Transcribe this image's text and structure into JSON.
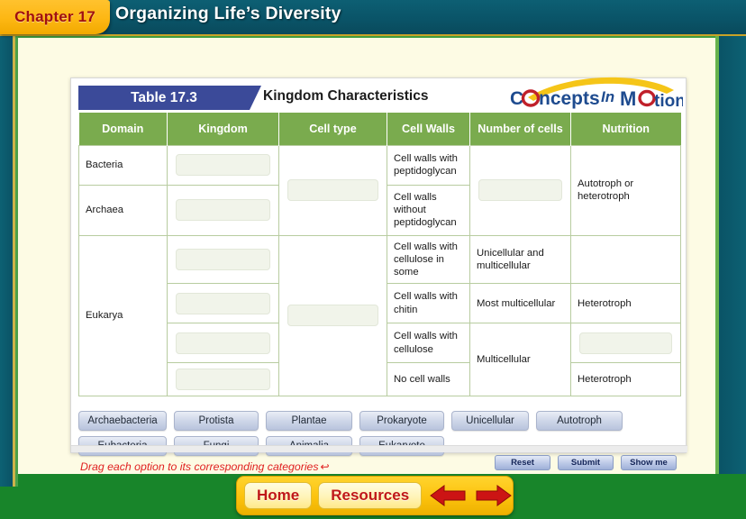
{
  "header": {
    "chapter_label": "Chapter 17",
    "title": "Organizing Life’s Diversity",
    "logo": {
      "word1": "C",
      "word1b": "ncepts",
      "word2": "In",
      "word3": "M",
      "word3b": "tion",
      "alt": "Concepts In Motion"
    }
  },
  "table": {
    "number": "Table 17.3",
    "caption": "Kingdom Characteristics",
    "columns": [
      "Domain",
      "Kingdom",
      "Cell type",
      "Cell Walls",
      "Number of cells",
      "Nutrition"
    ],
    "domains": [
      "Bacteria",
      "Archaea",
      "Eukarya"
    ],
    "cell_walls": [
      "Cell walls with peptidoglycan",
      "Cell walls without peptidoglycan",
      "Cell walls with cellulose in some",
      "Cell walls with chitin",
      "Cell walls with cellulose",
      "No cell walls"
    ],
    "number_of_cells": [
      "Unicellular and multicellular",
      "Most multicellular",
      "Multicellular"
    ],
    "nutrition": [
      "Autotroph or heterotroph",
      "Heterotroph",
      "Heterotroph"
    ]
  },
  "options": {
    "row1": [
      "Archaebacteria",
      "Protista",
      "Plantae",
      "Prokaryote",
      "Unicellular",
      "Autotroph"
    ],
    "row2": [
      "Eubacteria",
      "Fungi",
      "Animalia",
      "Eukaryote"
    ]
  },
  "instruction": {
    "text": "Drag each option to its corresponding categories",
    "arrow": "↩"
  },
  "actions": {
    "reset": "Reset",
    "submit": "Submit",
    "show_me": "Show me"
  },
  "bottom_nav": {
    "home": "Home",
    "resources": "Resources",
    "back_icon": "back-arrow-icon",
    "forward_icon": "forward-arrow-icon"
  },
  "colors": {
    "header_teal": "#0a5468",
    "chapter_yellow": "#fdb713",
    "chapter_text_red": "#a01010",
    "table_number_blue": "#3b4a99",
    "table_header_green": "#7aab4e",
    "instruction_red": "#e02020",
    "frame_green": "#18852a",
    "page_cream": "#fdfbe4",
    "nav_yellow": "#fcc20d",
    "nav_text_red": "#c01818"
  }
}
